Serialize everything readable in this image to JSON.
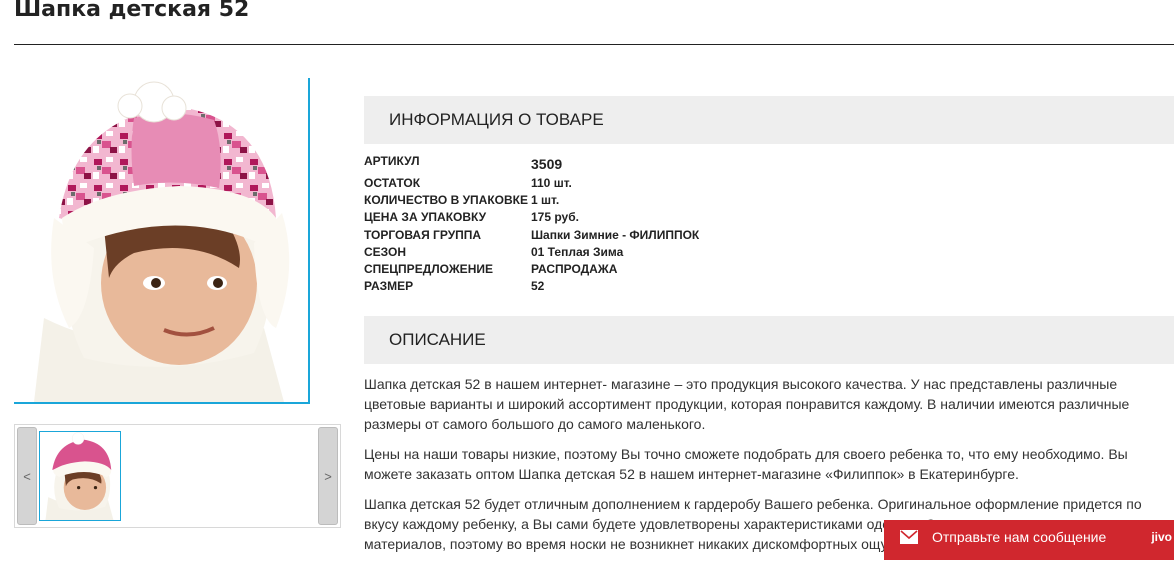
{
  "page": {
    "title": "Шапка детская 52"
  },
  "gallery": {
    "prev_label": "<",
    "next_label": ">"
  },
  "info": {
    "header": "ИНФОРМАЦИЯ О ТОВАРЕ",
    "properties": [
      {
        "label": "АРТИКУЛ",
        "value": "3509"
      },
      {
        "label": "ОСТАТОК",
        "value": "110 шт."
      },
      {
        "label": "КОЛИЧЕСТВО В УПАКОВКЕ",
        "value": "1 шт."
      },
      {
        "label": "ЦЕНА ЗА УПАКОВКУ",
        "value": "175 руб."
      },
      {
        "label": "ТОРГОВАЯ ГРУППА",
        "value": "Шапки Зимние - ФИЛИППОК"
      },
      {
        "label": "СЕЗОН",
        "value": "01 Теплая Зима"
      },
      {
        "label": "СПЕЦПРЕДЛОЖЕНИЕ",
        "value": "РАСПРОДАЖА"
      },
      {
        "label": "РАЗМЕР",
        "value": "52"
      }
    ]
  },
  "description": {
    "header": "ОПИСАНИЕ",
    "paragraphs": [
      "Шапка детская 52 в нашем интернет- магазине – это продукция высокого качества. У нас представлены различные цветовые варианты и широкий ассортимент продукции, которая понравится каждому. В наличии имеются различные размеры от самого большого до самого маленького.",
      "Цены на наши товары низкие, поэтому Вы точно сможете подобрать для своего ребенка то, что ему необходимо. Вы можете заказать оптом Шапка детская 52 в нашем интернет-магазине «Филиппок» в Екатеринбурге.",
      "Шапка детская 52 будет отличным дополнением к гардеробу Вашего ребенка. Оригинальное оформление придется по вкусу каждому ребенку, а Вы сами будете удовлетворены характеристиками одежды. Она изготовлена из мягких материалов, поэтому во время носки не возникнет никаких дискомфортных ощущений."
    ]
  },
  "chat": {
    "label": "Отправьте нам сообщение",
    "brand": "jivo",
    "icon": "envelope-icon"
  },
  "colors": {
    "accent_blue": "#1aa6d9",
    "chat_red": "#d0272e",
    "header_bg": "#eeeeee",
    "hat_pink": "#e78cb5"
  }
}
